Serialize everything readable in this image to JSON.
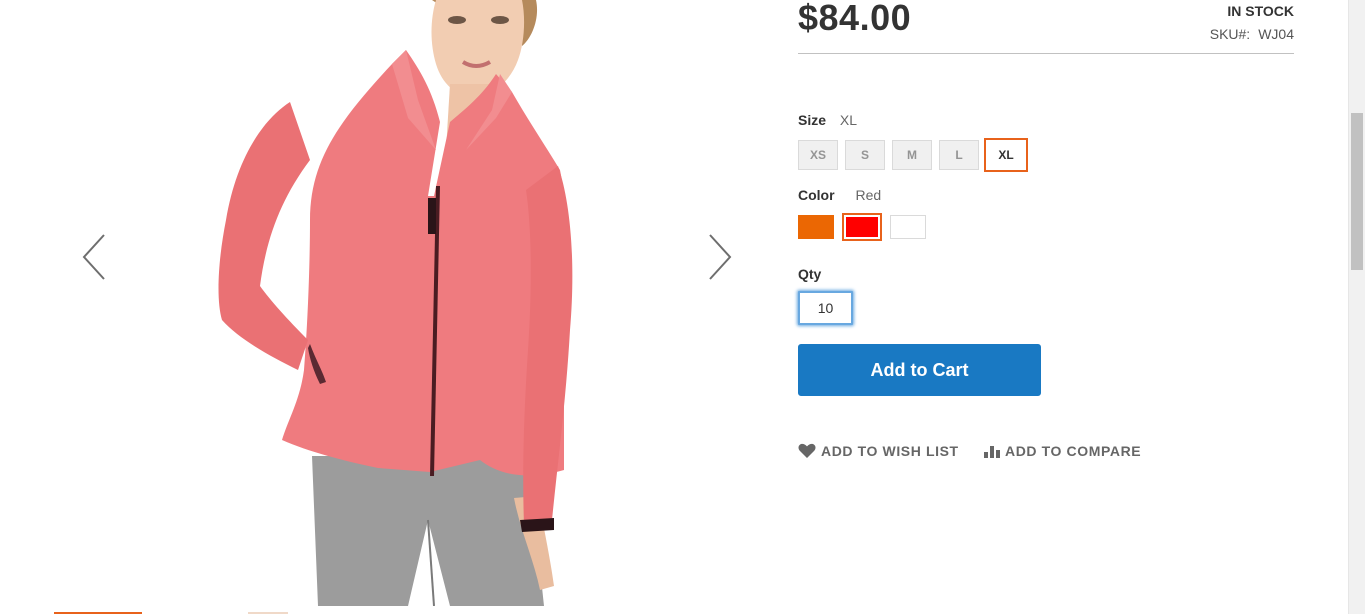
{
  "product": {
    "price": "$84.00",
    "stock_status": "IN STOCK",
    "sku_label": "SKU#:",
    "sku_value": "WJ04",
    "image_alt": "Pink women's jacket"
  },
  "size": {
    "label": "Size",
    "selected": "XL",
    "options": [
      "XS",
      "S",
      "M",
      "L",
      "XL"
    ]
  },
  "color": {
    "label": "Color",
    "selected": "Red",
    "options": [
      {
        "name": "Orange",
        "hex": "#eb6703"
      },
      {
        "name": "Red",
        "hex": "#ff0000"
      },
      {
        "name": "White",
        "hex": "#ffffff"
      }
    ]
  },
  "qty": {
    "label": "Qty",
    "value": "10"
  },
  "buttons": {
    "add_to_cart": "Add to Cart",
    "wish_list": "ADD TO WISH LIST",
    "compare": "ADD TO COMPARE"
  },
  "gallery": {
    "prev_icon": "chevron-left-icon",
    "next_icon": "chevron-right-icon"
  },
  "colors": {
    "accent": "#e8621b",
    "primary_button": "#1979c3",
    "jacket": "#ef7b7f"
  }
}
